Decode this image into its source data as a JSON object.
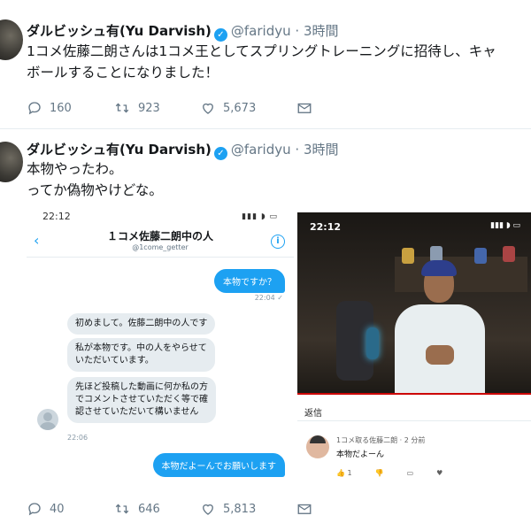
{
  "tweets": [
    {
      "author_name": "ダルビッシュ有(Yu Darvish)",
      "handle": "@faridyu",
      "separator": "·",
      "time": "3時間",
      "text_lines": [
        "1コメ佐藤二朗さんは1コメ王としてスプリングトレーニングに招待し、キャ",
        "ボールすることになりました！"
      ],
      "replies": "160",
      "retweets": "923",
      "likes": "5,673"
    },
    {
      "author_name": "ダルビッシュ有(Yu Darvish)",
      "handle": "@faridyu",
      "separator": "·",
      "time": "3時間",
      "text_lines": [
        "本物やったわ。",
        "ってか偽物やけどな。"
      ],
      "replies": "40",
      "retweets": "646",
      "likes": "5,813"
    }
  ],
  "dm_screenshot": {
    "status_time": "22:12",
    "title": "１コメ佐藤二朗中の人",
    "subtitle": "@1come_getter",
    "back_icon": "‹",
    "info_icon": "i",
    "outgoing_1": "本物ですか？",
    "outgoing_1_time": "22:04 ✓",
    "incoming": [
      "初めまして。佐藤二朗中の人です",
      "私が本物です。中の人をやらせて",
      "いただいています。",
      "先ほど投稿した動画に何か私の方",
      "でコメントさせていただく等で確",
      "認させていただいて構いません"
    ],
    "incoming_time": "22:06",
    "outgoing_2": "本物だよーんでお願いします"
  },
  "video_screenshot": {
    "status_time": "22:12",
    "reply_label": "返信",
    "comment_meta": "1コメ取る佐藤二朗 · 2 分前",
    "comment_text": "本物だよーん",
    "comment_likes": "1"
  },
  "icons": {
    "verified": "verified-badge",
    "reply": "reply-icon",
    "retweet": "retweet-icon",
    "like": "heart-icon",
    "dm": "mail-icon"
  },
  "colors": {
    "accent": "#1da1f2",
    "muted": "#657786"
  }
}
